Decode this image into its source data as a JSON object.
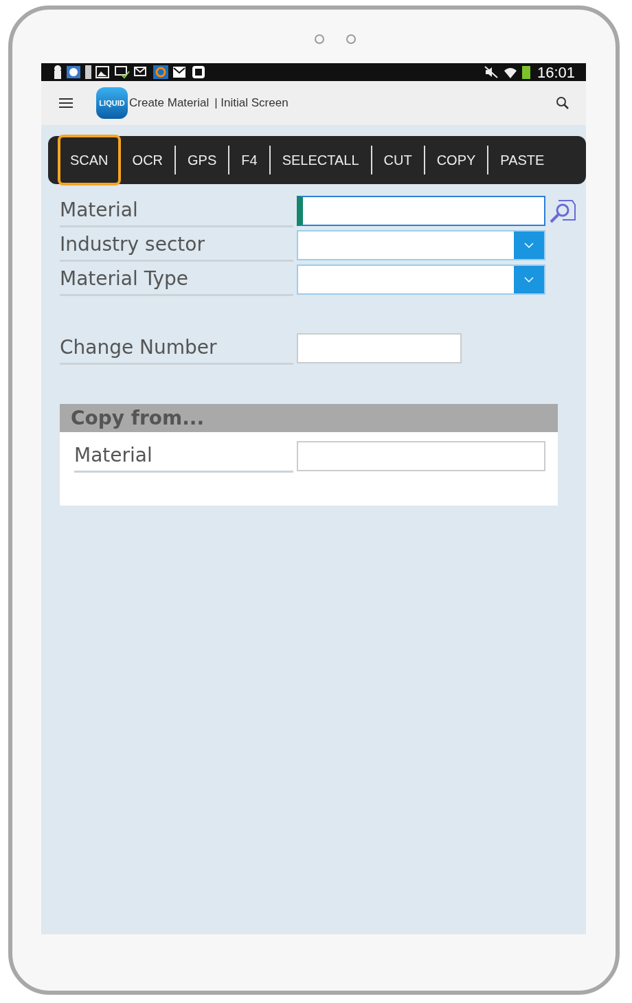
{
  "status_bar": {
    "time": "16:01"
  },
  "header": {
    "logo_text": "LIQUID",
    "title": "Create Material",
    "subtitle": "| Initial Screen"
  },
  "toolbar": [
    {
      "label": "SCAN",
      "selected": true
    },
    {
      "label": "OCR",
      "selected": false
    },
    {
      "label": "GPS",
      "selected": false
    },
    {
      "label": "F4",
      "selected": false
    },
    {
      "label": "SELECTALL",
      "selected": false
    },
    {
      "label": "CUT",
      "selected": false
    },
    {
      "label": "COPY",
      "selected": false
    },
    {
      "label": "PASTE",
      "selected": false
    }
  ],
  "fields": [
    {
      "label": "Material",
      "kind": "search",
      "focused": true
    },
    {
      "label": "Industry sector",
      "kind": "dropdown",
      "focused": false
    },
    {
      "label": "Material Type",
      "kind": "dropdown",
      "focused": false
    },
    {
      "label": "Change Number",
      "kind": "short",
      "focused": false
    }
  ],
  "copy_from": {
    "title": "Copy from...",
    "fields": [
      {
        "label": "Material",
        "kind": "text",
        "focused": false
      }
    ]
  }
}
